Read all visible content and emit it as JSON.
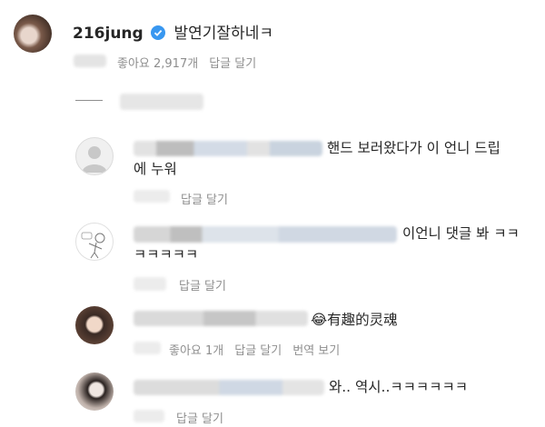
{
  "post": {
    "username": "216jung",
    "caption": "발연기잘하네ㅋ",
    "likes": "좋아요 2,917개",
    "reply": "답글 달기"
  },
  "comments": [
    {
      "text_line1": "핸드 보러왔다가 이 언니 드립",
      "text_line2": "에 누워",
      "reply": "답글 달기"
    },
    {
      "text_line1": "이언니 댓글 봐 ㅋㅋ",
      "text_line2": "ㅋㅋㅋㅋㅋ",
      "reply": "답글 달기"
    },
    {
      "emoji": "😂",
      "text_line1": "有趣的灵魂",
      "likes": "좋아요 1개",
      "reply": "답글 달기",
      "translate": "번역 보기"
    },
    {
      "text_line1": "와.. 역시..ㅋㅋㅋㅋㅋㅋ",
      "reply": "답글 달기"
    }
  ],
  "colors": {
    "verified": "#3897f0",
    "meta": "#8e8e8e",
    "text": "#262626"
  },
  "icons": {
    "verified": "verified-badge-icon",
    "default_avatar": "default-avatar-icon"
  }
}
